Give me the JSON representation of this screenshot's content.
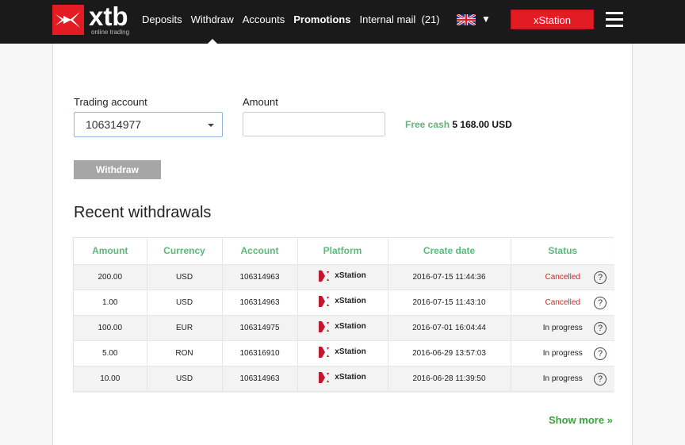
{
  "header": {
    "logo": {
      "name": "xtb",
      "tagline": "online trading"
    },
    "nav": [
      {
        "label": "Deposits",
        "bold": false
      },
      {
        "label": "Withdraw",
        "bold": false,
        "active": true
      },
      {
        "label": "Accounts",
        "bold": false
      },
      {
        "label": "Promotions",
        "bold": true
      },
      {
        "label": "Internal mail  (21)",
        "bold": false
      }
    ],
    "language_icon": "uk-flag-icon",
    "language_caret": "▼",
    "xstation_button": "xStation",
    "menu_icon": "hamburger-icon",
    "colors": {
      "brand_red": "#e31b23",
      "topbar_bg": "#1a1a1a"
    }
  },
  "form": {
    "trading_account_label": "Trading account",
    "trading_account_value": "106314977",
    "amount_label": "Amount",
    "amount_value": "",
    "free_cash_label": "Free cash",
    "free_cash_value": "5 168.00 USD",
    "withdraw_button": "Withdraw"
  },
  "recent": {
    "title": "Recent withdrawals",
    "columns": [
      "Amount",
      "Currency",
      "Account",
      "Platform",
      "Create date",
      "Status"
    ],
    "rows": [
      {
        "amount": "200.00",
        "currency": "USD",
        "account": "106314963",
        "platform": "xStation",
        "date": "2016-07-15 11:44:36",
        "status": "Cancelled"
      },
      {
        "amount": "1.00",
        "currency": "USD",
        "account": "106314963",
        "platform": "xStation",
        "date": "2016-07-15 11:43:10",
        "status": "Cancelled"
      },
      {
        "amount": "100.00",
        "currency": "EUR",
        "account": "106314975",
        "platform": "xStation",
        "date": "2016-07-01 16:04:44",
        "status": "In progress"
      },
      {
        "amount": "5.00",
        "currency": "RON",
        "account": "106316910",
        "platform": "xStation",
        "date": "2016-06-29 13:57:03",
        "status": "In progress"
      },
      {
        "amount": "10.00",
        "currency": "USD",
        "account": "106314963",
        "platform": "xStation",
        "date": "2016-06-28 11:39:50",
        "status": "In progress"
      }
    ],
    "help_icon_glyph": "?",
    "show_more": "Show more »",
    "colors": {
      "header_green": "#5cb87a",
      "cancelled_red": "#e31b23",
      "link_green": "#3ea33e"
    }
  }
}
